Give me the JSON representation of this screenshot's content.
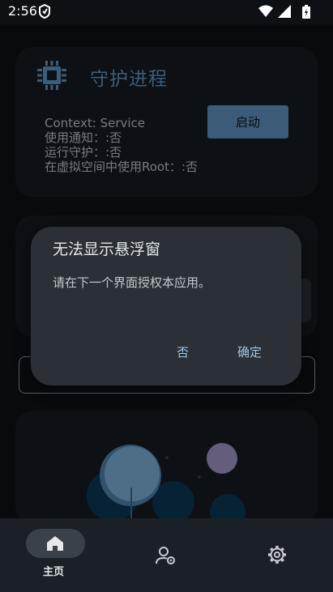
{
  "status_bar": {
    "time": "2:56",
    "icons": [
      "wifi-icon",
      "signal-icon",
      "battery-icon"
    ]
  },
  "guard_card": {
    "title": "守护进程",
    "icon": "cpu-chip-icon",
    "lines": [
      "Context: Service",
      "使用通知：:否",
      "运行守护：:否",
      "在虚拟空间中使用Root：:否"
    ],
    "start_button": "启动"
  },
  "dialog": {
    "title": "无法显示悬浮窗",
    "message": "请在下一个界面授权本应用。",
    "negative": "否",
    "positive": "确定"
  },
  "bottom_nav": {
    "items": [
      {
        "label": "主页",
        "icon": "home-icon",
        "selected": true
      },
      {
        "label": "",
        "icon": "profile-gear-icon",
        "selected": false
      },
      {
        "label": "",
        "icon": "settings-icon",
        "selected": false
      }
    ]
  },
  "colors": {
    "accent": "#5b8db9",
    "background": "#0d1116",
    "dialog": "#2a3036"
  }
}
